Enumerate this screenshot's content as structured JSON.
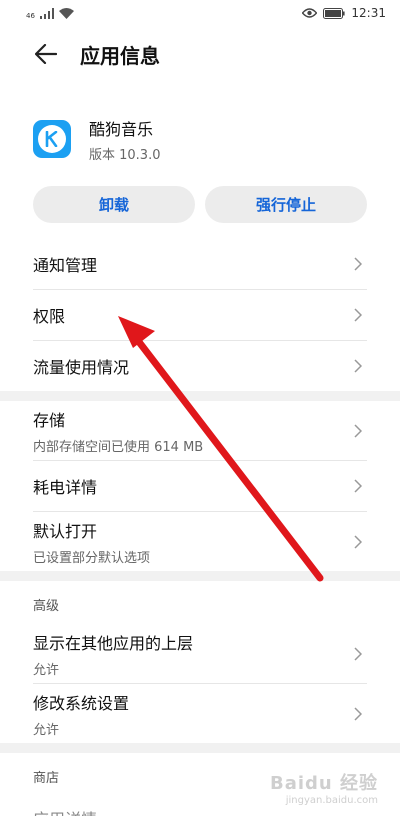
{
  "statusbar": {
    "signal_tag": "46",
    "time": "12:31"
  },
  "header": {
    "title": "应用信息"
  },
  "app": {
    "name": "酷狗音乐",
    "version": "版本 10.3.0",
    "brand_color": "#1ca0f2"
  },
  "actions": {
    "uninstall": "卸载",
    "force_stop": "强行停止"
  },
  "list": {
    "notifications": "通知管理",
    "permissions": "权限",
    "data_usage": "流量使用情况",
    "storage": {
      "title": "存储",
      "sub": "内部存储空间已使用 614 MB"
    },
    "battery": "耗电详情",
    "default_open": {
      "title": "默认打开",
      "sub": "已设置部分默认选项"
    }
  },
  "advanced": {
    "label": "高级",
    "overlay": {
      "title": "显示在其他应用的上层",
      "sub": "允许"
    },
    "modify_settings": {
      "title": "修改系统设置",
      "sub": "允许"
    }
  },
  "store": {
    "label": "商店",
    "app_details": "应用详情"
  },
  "watermark": {
    "logo": "Baidu 经验",
    "url": "jingyan.baidu.com"
  },
  "colors": {
    "accent_blue": "#1565d8",
    "arrow_red": "#e0171b"
  }
}
